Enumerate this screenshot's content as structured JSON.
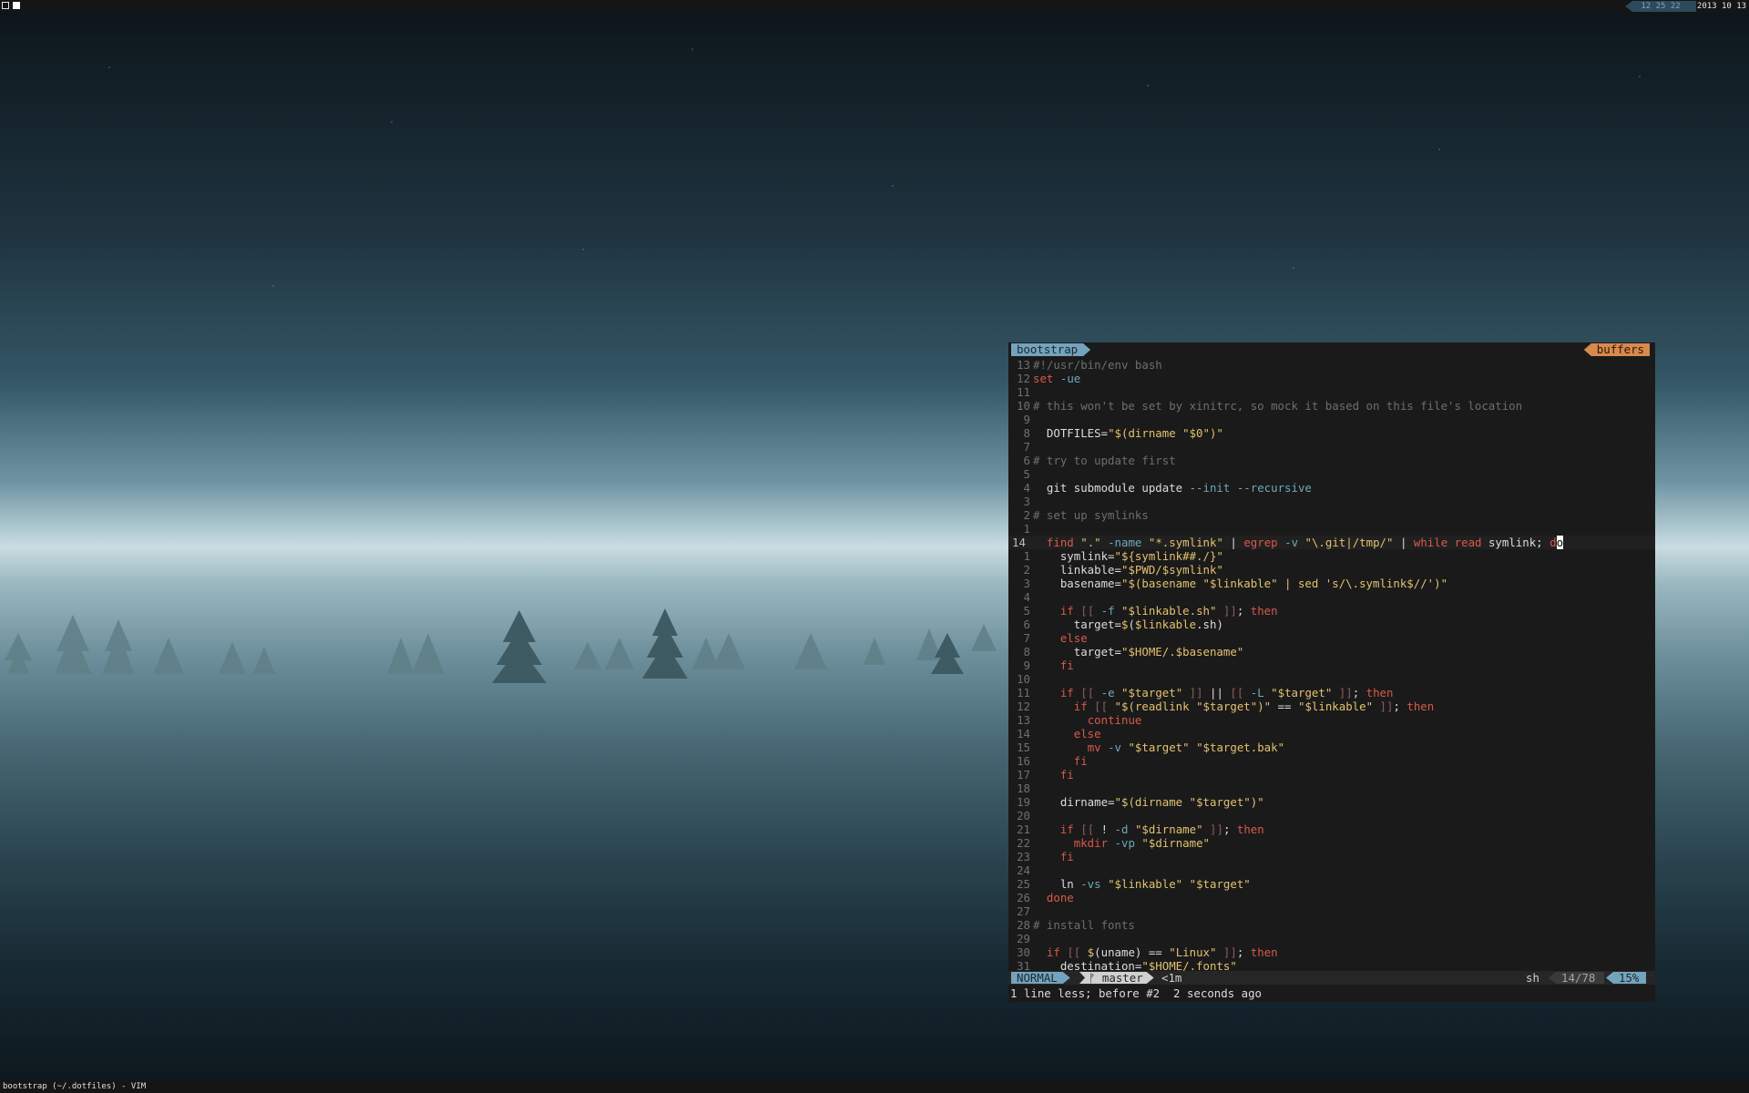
{
  "topbar": {
    "time": "12 25 22",
    "date": "2013 10 13"
  },
  "bottombar": {
    "window_title": "bootstrap (~/.dotfiles) - VIM"
  },
  "vim": {
    "tab_active": "bootstrap",
    "tab_buffers": "buffers",
    "line_numbers": [
      "13",
      "12",
      "11",
      "10",
      "9",
      "8",
      "7",
      "6",
      "5",
      "4",
      "3",
      "2",
      "1",
      "14",
      "1",
      "2",
      "3",
      "4",
      "5",
      "6",
      "7",
      "8",
      "9",
      "10",
      "11",
      "12",
      "13",
      "14",
      "15",
      "16",
      "17",
      "18",
      "19",
      "20",
      "21",
      "22",
      "23",
      "24",
      "25",
      "26",
      "27",
      "28",
      "29",
      "30",
      "31"
    ],
    "lines": [
      "#!/usr/bin/env bash",
      "set -ue",
      "",
      "# this won't be set by xinitrc, so mock it based on this file's location",
      "",
      "  DOTFILES=\"$(dirname \"$0\")\"",
      "",
      "# try to update first",
      "",
      "  git submodule update --init --recursive",
      "",
      "# set up symlinks",
      "",
      "  find \".\" -name \"*.symlink\" | egrep -v \"\\.git|/tmp/\" | while read symlink; do",
      "    symlink=\"${symlink##./}\"",
      "    linkable=\"$PWD/$symlink\"",
      "    basename=\"$(basename \"$linkable\" | sed 's/\\.symlink$//')\"",
      "",
      "    if [[ -f \"$linkable.sh\" ]]; then",
      "      target=$($linkable.sh)",
      "    else",
      "      target=\"$HOME/.$basename\"",
      "    fi",
      "",
      "    if [[ -e \"$target\" ]] || [[ -L \"$target\" ]]; then",
      "      if [[ \"$(readlink \"$target\")\" == \"$linkable\" ]]; then",
      "        continue",
      "      else",
      "        mv -v \"$target\" \"$target.bak\"",
      "      fi",
      "    fi",
      "",
      "    dirname=\"$(dirname \"$target\")\"",
      "",
      "    if [[ ! -d \"$dirname\" ]]; then",
      "      mkdir -vp \"$dirname\"",
      "    fi",
      "",
      "    ln -vs \"$linkable\" \"$target\"",
      "  done",
      "",
      "# install fonts",
      "",
      "  if [[ $(uname) == \"Linux\" ]]; then",
      "    destination=\"$HOME/.fonts\""
    ],
    "status": {
      "mode": "NORMAL",
      "branch": "ᚠ master",
      "modified": "<1m",
      "filetype": "sh",
      "position": "14/78",
      "percent": "15%"
    },
    "message": "1 line less; before #2  2 seconds ago"
  }
}
